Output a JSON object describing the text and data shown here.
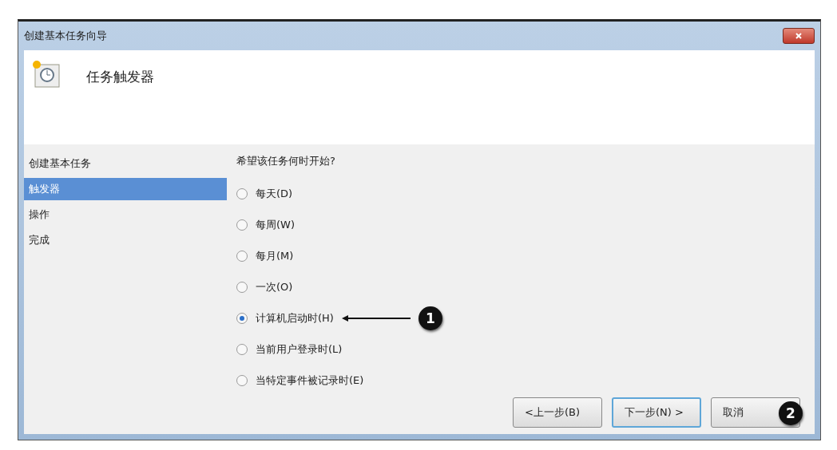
{
  "window": {
    "title": "创建基本任务向导"
  },
  "header": {
    "title": "任务触发器"
  },
  "steps": [
    {
      "label": "创建基本任务",
      "selected": false
    },
    {
      "label": "触发器",
      "selected": true
    },
    {
      "label": "操作",
      "selected": false
    },
    {
      "label": "完成",
      "selected": false
    }
  ],
  "question": "希望该任务何时开始?",
  "options": [
    {
      "label": "每天(D)",
      "selected": false
    },
    {
      "label": "每周(W)",
      "selected": false
    },
    {
      "label": "每月(M)",
      "selected": false
    },
    {
      "label": "一次(O)",
      "selected": false
    },
    {
      "label": "计算机启动时(H)",
      "selected": true,
      "callout": "1"
    },
    {
      "label": "当前用户登录时(L)",
      "selected": false
    },
    {
      "label": "当特定事件被记录时(E)",
      "selected": false
    }
  ],
  "buttons": [
    {
      "label": "<上一步(B)",
      "focused": false
    },
    {
      "label": "下一步(N) >",
      "focused": true
    },
    {
      "label": "取消",
      "focused": false,
      "callout": "2"
    }
  ]
}
